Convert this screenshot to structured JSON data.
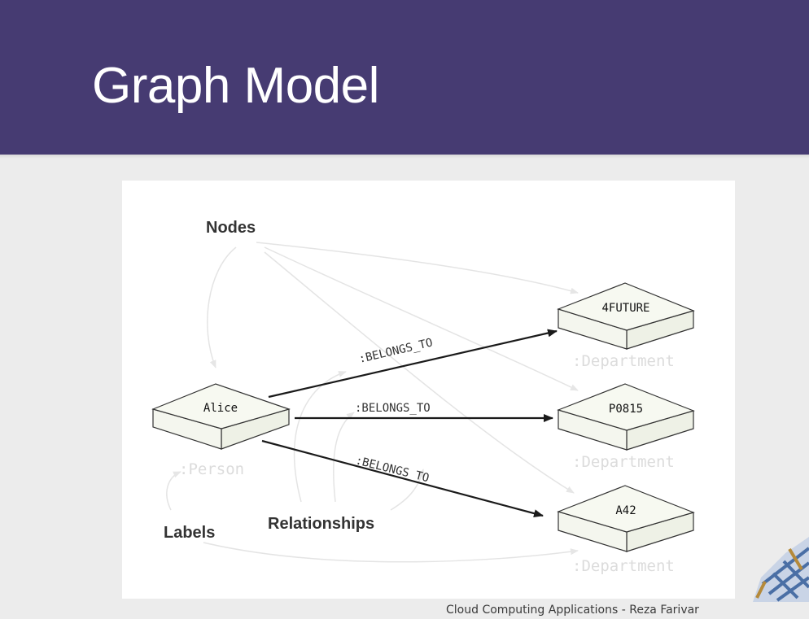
{
  "slide": {
    "title": "Graph Model",
    "footer": "Cloud Computing Applications - Reza Farivar"
  },
  "diagram": {
    "annotations": {
      "nodes": "Nodes",
      "labels": "Labels",
      "relationships": "Relationships"
    },
    "nodes": [
      {
        "id": "alice",
        "name": "Alice",
        "label": ":Person"
      },
      {
        "id": "4future",
        "name": "4FUTURE",
        "label": ":Department"
      },
      {
        "id": "p0815",
        "name": "P0815",
        "label": ":Department"
      },
      {
        "id": "a42",
        "name": "A42",
        "label": ":Department"
      }
    ],
    "relationships": [
      {
        "from": "alice",
        "to": "4future",
        "type": ":BELONGS_TO"
      },
      {
        "from": "alice",
        "to": "p0815",
        "type": ":BELONGS_TO"
      },
      {
        "from": "alice",
        "to": "a42",
        "type": ":BELONGS_TO"
      }
    ]
  }
}
